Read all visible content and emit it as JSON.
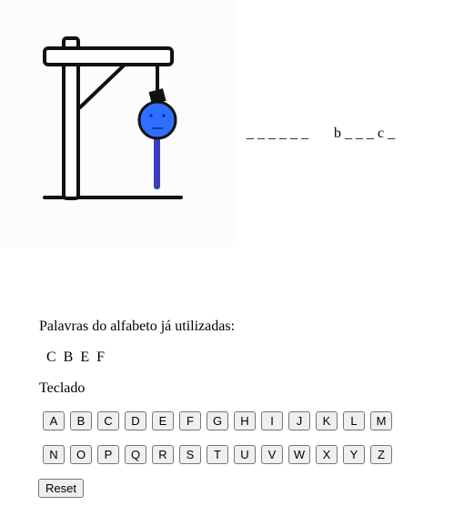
{
  "word_display": {
    "group1": "_ _ _ _ _ _",
    "group2": "b _ _ _ c _"
  },
  "used_letters": {
    "label": "Palavras do alfabeto já utilizadas:",
    "letters": "C  B  E  F"
  },
  "keyboard": {
    "label": "Teclado",
    "row1": [
      "A",
      "B",
      "C",
      "D",
      "E",
      "F",
      "G",
      "H",
      "I",
      "J",
      "K",
      "L",
      "M"
    ],
    "row2": [
      "N",
      "O",
      "P",
      "Q",
      "R",
      "S",
      "T",
      "U",
      "V",
      "W",
      "X",
      "Y",
      "Z"
    ]
  },
  "reset_label": "Reset",
  "colors": {
    "gallows": "#111111",
    "head": "#2f6fff",
    "body": "#3b3fbf"
  }
}
